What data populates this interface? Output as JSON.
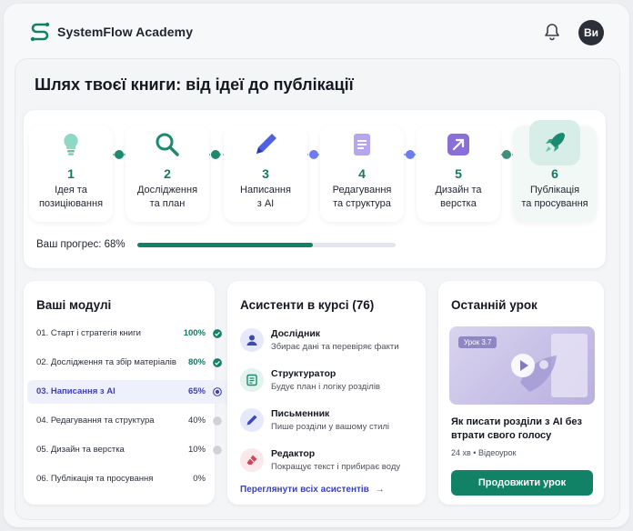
{
  "app": {
    "brand": "SystemFlow Academy",
    "avatar_initials": "Ви",
    "accent": "#128267",
    "brand_indigo": "#3c3fb8"
  },
  "page": {
    "title": "Шлях твоєї книги: від ідеї до публікації"
  },
  "roadmap": {
    "steps": [
      {
        "num": "1",
        "label": "Ідея та\nпозиціювання",
        "icon": "lightbulb-icon"
      },
      {
        "num": "2",
        "label": "Дослідження\nта план",
        "icon": "magnifier-icon"
      },
      {
        "num": "3",
        "label": "Написання\nз AI",
        "icon": "pen-icon"
      },
      {
        "num": "4",
        "label": "Редагування\nта структура",
        "icon": "document-icon"
      },
      {
        "num": "5",
        "label": "Дизайн та\nверстка",
        "icon": "design-icon"
      },
      {
        "num": "6",
        "label": "Публікація\nта просування",
        "icon": "rocket-icon"
      }
    ],
    "progress_label": "Ваш прогрес: 68%",
    "progress_value": 0.68
  },
  "modules": {
    "title": "Ваші модулі",
    "items": [
      {
        "name": "01. Старт і стратегія книги",
        "pct": "100%",
        "status": "done"
      },
      {
        "name": "02. Дослідження та збір матеріалів",
        "pct": "80%",
        "status": "done"
      },
      {
        "name": "03. Написання з AI",
        "pct": "65%",
        "status": "current"
      },
      {
        "name": "04. Редагування та структура",
        "pct": "40%",
        "status": "pending"
      },
      {
        "name": "05. Дизайн та верстка",
        "pct": "10%",
        "status": "pending"
      },
      {
        "name": "06. Публікація та просування",
        "pct": "0%",
        "status": "none"
      }
    ]
  },
  "assistants": {
    "title": "Асистенти в курсі (76)",
    "items": [
      {
        "name": "Дослідник",
        "desc": "Збирає дані та перевіряє факти",
        "icon": "user-icon"
      },
      {
        "name": "Структуратор",
        "desc": "Будує план і логіку розділів",
        "icon": "outline-icon"
      },
      {
        "name": "Письменник",
        "desc": "Пише розділи у вашому стилі",
        "icon": "pen-icon"
      },
      {
        "name": "Редактор",
        "desc": "Покращує текст і прибирає воду",
        "icon": "eraser-icon"
      }
    ],
    "link": "Переглянути всіх асистентів"
  },
  "lesson": {
    "title": "Останній урок",
    "tag": "Урок 3.7",
    "name": "Як писати розділи з AI без втрати свого голосу",
    "meta": "24 хв • Відеоурок",
    "cta": "Продовжити урок"
  }
}
